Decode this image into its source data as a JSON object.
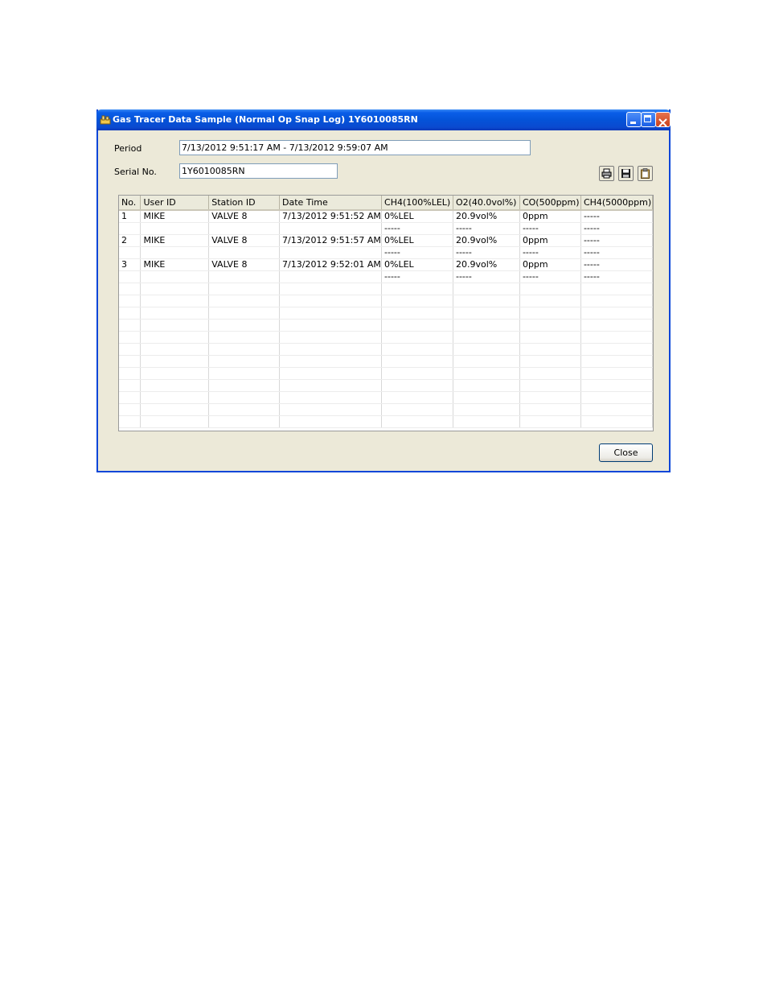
{
  "window": {
    "title": "Gas Tracer Data Sample (Normal Op Snap Log) 1Y6010085RN",
    "accent_color": "#0a5ee8",
    "controls": [
      "minimize-icon",
      "maximize-icon",
      "close-icon"
    ]
  },
  "form": {
    "period_label": "Period",
    "period_value": "7/13/2012 9:51:17 AM - 7/13/2012 9:59:07 AM",
    "serial_label": "Serial No.",
    "serial_value": "1Y6010085RN"
  },
  "toolbar": {
    "icons": [
      "print-icon",
      "save-icon",
      "clipboard-icon"
    ]
  },
  "table": {
    "columns": [
      "No.",
      "User ID",
      "Station ID",
      "Date Time",
      "CH4(100%LEL)",
      "O2(40.0vol%)",
      "CO(500ppm)",
      "CH4(5000ppm)"
    ],
    "rows": [
      [
        "1",
        "MIKE",
        "VALVE 8",
        "7/13/2012 9:51:52 AM",
        "0%LEL",
        "20.9vol%",
        "0ppm",
        "-----"
      ],
      [
        "",
        "",
        "",
        "",
        "-----",
        "-----",
        "-----",
        "-----"
      ],
      [
        "2",
        "MIKE",
        "VALVE 8",
        "7/13/2012 9:51:57 AM",
        "0%LEL",
        "20.9vol%",
        "0ppm",
        "-----"
      ],
      [
        "",
        "",
        "",
        "",
        "-----",
        "-----",
        "-----",
        "-----"
      ],
      [
        "3",
        "MIKE",
        "VALVE 8",
        "7/13/2012 9:52:01 AM",
        "0%LEL",
        "20.9vol%",
        "0ppm",
        "-----"
      ],
      [
        "",
        "",
        "",
        "",
        "-----",
        "-----",
        "-----",
        "-----"
      ]
    ]
  },
  "footer": {
    "close_label": "Close"
  }
}
